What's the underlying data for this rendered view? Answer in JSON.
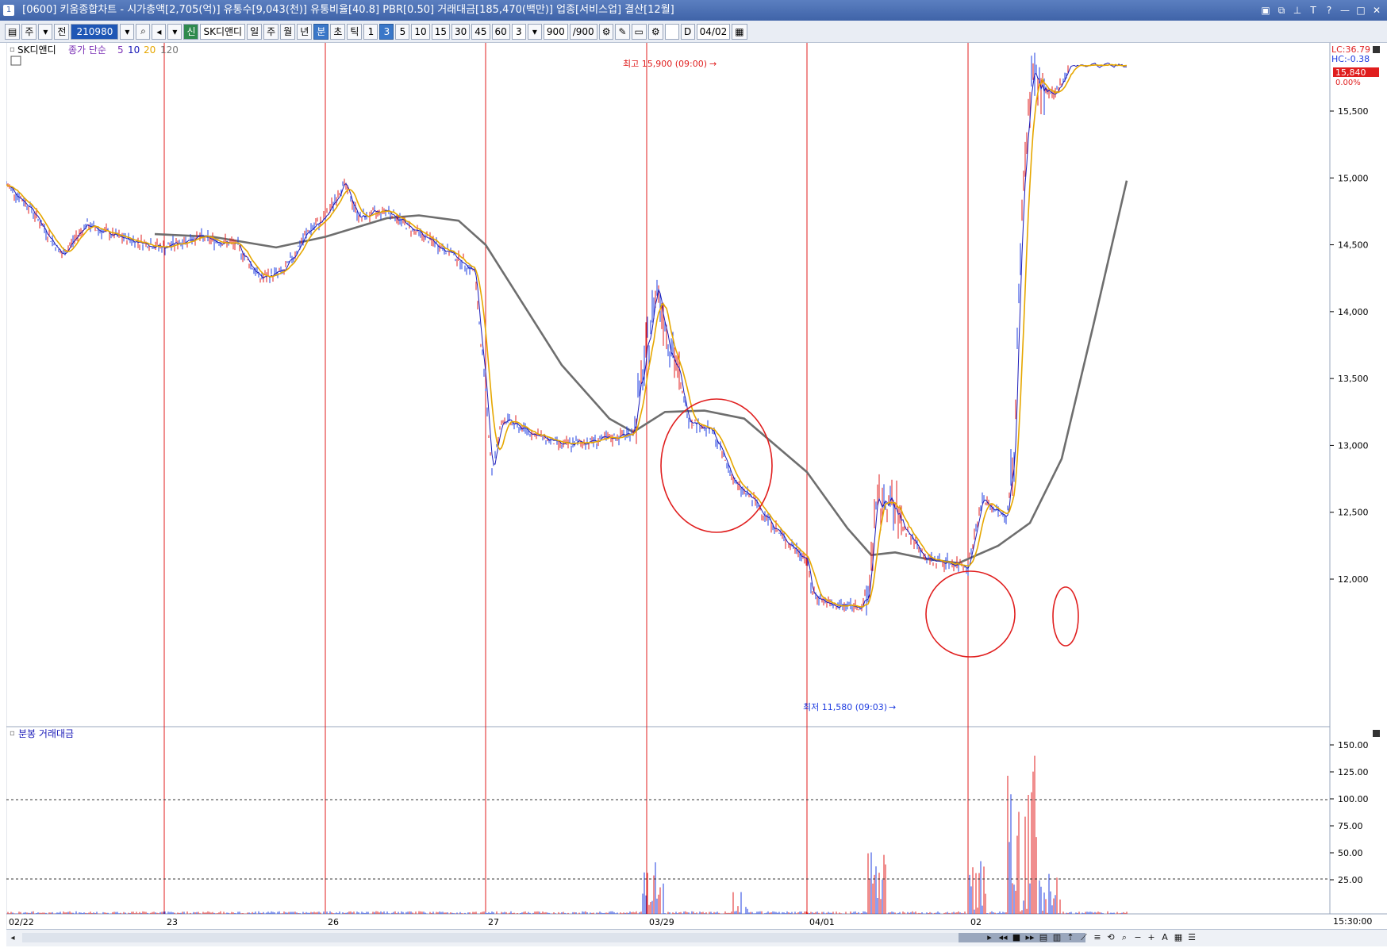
{
  "window": {
    "title": "[0600] 키움종합차트 - 시가총액[2,705(억)] 유통수[9,043(천)] 유통비율[40.8] PBR[0.50] 거래대금[185,470(백만)] 업종[서비스업] 결산[12월]",
    "icon_label": "1"
  },
  "toolbar": {
    "market": "주",
    "mode": "전",
    "code": "210980",
    "stock_name": "SK디앤디",
    "new_badge": "신",
    "periods": [
      "일",
      "주",
      "월",
      "년",
      "분",
      "초",
      "틱"
    ],
    "selected_period": "분",
    "intervals": [
      "1",
      "3",
      "5",
      "10",
      "15",
      "30",
      "45",
      "60"
    ],
    "selected_interval": "3",
    "count_select": "3",
    "count_display": "900",
    "count_max": "/900",
    "d_label": "D",
    "date": "04/02"
  },
  "price_panel": {
    "legend_stock": "SK디앤디",
    "legend_indicator": "종가 단순",
    "ma_periods": [
      "5",
      "10",
      "20",
      "120"
    ],
    "high_annotation": "최고 15,900 (09:00)",
    "low_annotation": "최저 11,580 (09:03)",
    "lc_label": "LC:36.79",
    "hc_label": "HC:-0.38",
    "current_price": "15,840",
    "change_pct": "0.00%"
  },
  "volume_panel": {
    "legend": "분봉 거래대금"
  },
  "x_axis_labels": [
    "02/22",
    "23",
    "26",
    "27",
    "03/29",
    "04/01",
    "02"
  ],
  "y_axis_price_labels": [
    "15,500",
    "15,000",
    "14,500",
    "14,000",
    "13,500",
    "13,000",
    "12,500",
    "12,000"
  ],
  "y_axis_volume_labels": [
    "150.00",
    "125.00",
    "100.00",
    "75.00",
    "50.00",
    "25.00"
  ],
  "time_label": "15:30:00",
  "colors": {
    "ma5": "#1a1ab8",
    "ma10": "#3a3aa0",
    "ma20": "#e6a700",
    "ma120": "#6e6e6e",
    "up": "#e01e1e",
    "down": "#1e3ce0",
    "session_line": "#e01e1e",
    "price_tag_bg": "#e01e1e",
    "highlight_circle": "#e01e1e"
  },
  "chart_data": {
    "type": "line",
    "title": "",
    "ylabel": "",
    "ylim": [
      11580,
      15960
    ],
    "x": [
      "02/22",
      "23",
      "26",
      "27",
      "03/29",
      "04/01",
      "02"
    ],
    "series": [
      {
        "name": "종가",
        "values": [
          14890,
          14560,
          14480,
          14700,
          12900,
          13000,
          12100,
          11790,
          12200,
          15840
        ]
      },
      {
        "name": "120",
        "values": [
          14580,
          14560,
          14540,
          14720,
          14640,
          12960,
          13110,
          12720,
          12180,
          12140,
          12420,
          13300,
          14980
        ]
      }
    ],
    "high": 15900,
    "low": 11580,
    "last": 15840
  }
}
